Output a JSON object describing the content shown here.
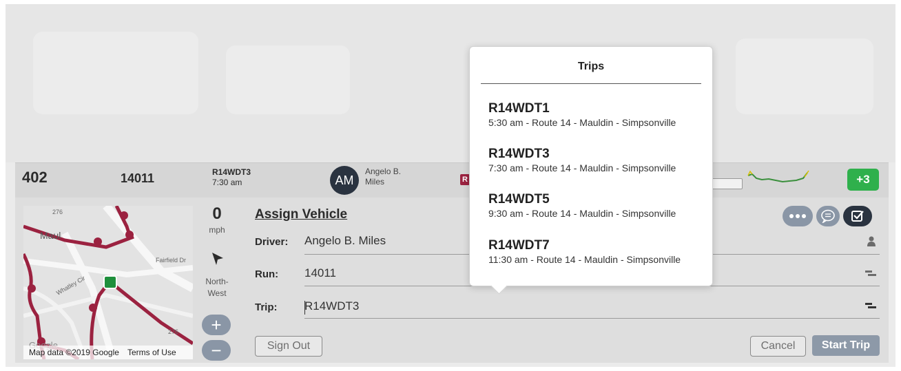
{
  "vehicle": {
    "id": "402",
    "run": "14011",
    "trip_code": "R14WDT3",
    "trip_time": "7:30 am",
    "driver_initials": "AM",
    "driver_first": "Angelo B.",
    "driver_last": "Miles",
    "route_tag": "R",
    "delta_badge": "+3"
  },
  "map": {
    "attribution": "Map data ©2019 Google",
    "terms": "Terms of Use",
    "labels": [
      "276",
      "Maul",
      "Fairfield Dr",
      "Whatley Cir",
      "276",
      "Google"
    ]
  },
  "telemetry": {
    "speed": "0",
    "speed_unit": "mph",
    "direction_line1": "North-",
    "direction_line2": "West",
    "zoom_in": "+",
    "zoom_out": "−"
  },
  "form": {
    "title": "Assign Vehicle",
    "driver_label": "Driver:",
    "driver_value": "Angelo B. Miles",
    "run_label": "Run:",
    "run_value": "14011",
    "trip_label": "Trip:",
    "trip_value": "R14WDT3",
    "sign_out": "Sign Out",
    "cancel": "Cancel",
    "start_trip": "Start Trip"
  },
  "popup": {
    "title": "Trips",
    "trips": [
      {
        "code": "R14WDT1",
        "desc": "5:30 am - Route 14 - Mauldin - Simpsonville"
      },
      {
        "code": "R14WDT3",
        "desc": "7:30 am - Route 14 - Mauldin - Simpsonville"
      },
      {
        "code": "R14WDT5",
        "desc": "9:30 am - Route 14 - Mauldin - Simpsonville"
      },
      {
        "code": "R14WDT7",
        "desc": "11:30 am - Route 14 - Mauldin - Simpsonville"
      }
    ]
  },
  "colors": {
    "route": "#9b2240",
    "badge": "#2fb04c",
    "button": "#8d99a8",
    "avatar": "#2a3340"
  },
  "icons": [
    "person-icon",
    "run-icon",
    "trip-icon",
    "more-icon",
    "chat-icon",
    "checkbox-icon",
    "navigation-arrow-icon"
  ]
}
